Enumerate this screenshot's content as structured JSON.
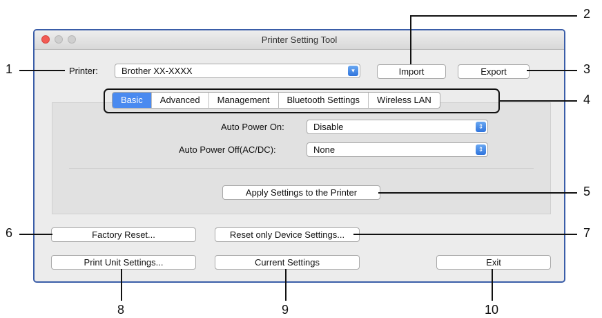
{
  "window": {
    "title": "Printer Setting Tool"
  },
  "printer_row": {
    "label": "Printer:",
    "value": "Brother XX-XXXX",
    "import_label": "Import",
    "export_label": "Export"
  },
  "tabs": [
    {
      "label": "Basic",
      "selected": true
    },
    {
      "label": "Advanced",
      "selected": false
    },
    {
      "label": "Management",
      "selected": false
    },
    {
      "label": "Bluetooth Settings",
      "selected": false
    },
    {
      "label": "Wireless LAN",
      "selected": false
    }
  ],
  "settings": {
    "auto_power_on": {
      "label": "Auto Power On:",
      "value": "Disable"
    },
    "auto_power_off": {
      "label": "Auto Power Off(AC/DC):",
      "value": "None"
    },
    "apply_label": "Apply Settings to the Printer"
  },
  "buttons": {
    "factory_reset": "Factory Reset...",
    "reset_device": "Reset only Device Settings...",
    "print_unit": "Print Unit Settings...",
    "current_settings": "Current Settings",
    "exit": "Exit"
  },
  "callouts": [
    "1",
    "2",
    "3",
    "4",
    "5",
    "6",
    "7",
    "8",
    "9",
    "10"
  ],
  "colors": {
    "accent": "#4a8af0",
    "close": "#f25b54",
    "window_border": "#3a5da8"
  }
}
